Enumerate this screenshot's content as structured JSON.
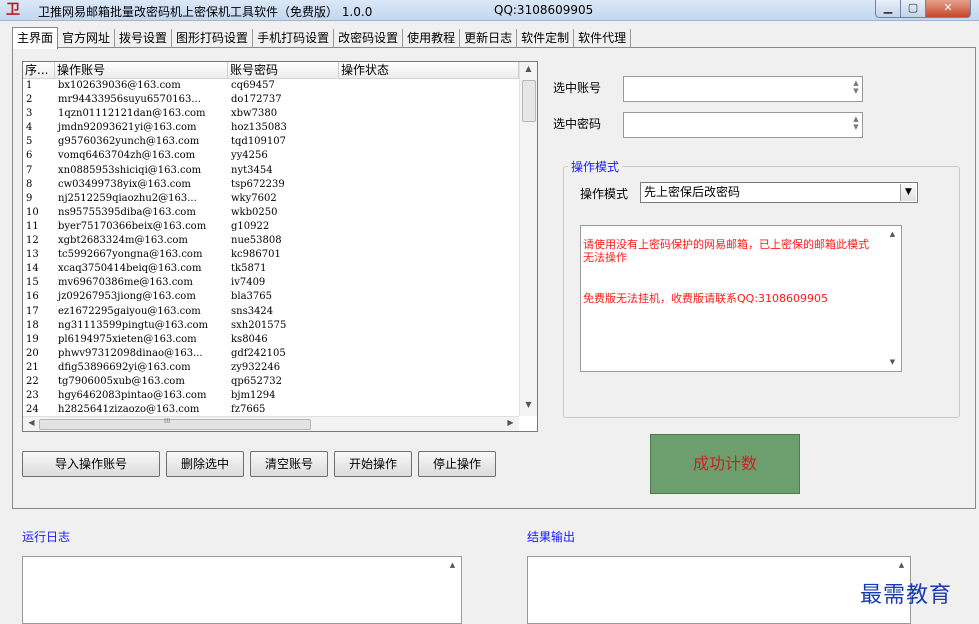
{
  "window": {
    "title": "卫推网易邮箱批量改密码机上密保机工具软件（免费版）  1.0.0",
    "qq": "QQ:3108609905",
    "min_label": "▁",
    "max_label": "▢",
    "close_label": "✕"
  },
  "tabs": [
    "主界面",
    "官方网址",
    "拨号设置",
    "图形打码设置",
    "手机打码设置",
    "改密码设置",
    "使用教程",
    "更新日志",
    "软件定制",
    "软件代理"
  ],
  "list": {
    "headers": [
      "序...",
      "操作账号",
      "账号密码",
      "操作状态"
    ],
    "rows": [
      [
        "1",
        "bx102639036@163.com",
        "cq69457",
        ""
      ],
      [
        "2",
        "mr94433956suyu6570163...",
        "do172737",
        ""
      ],
      [
        "3",
        "1qzn01112121dan@163.com",
        "xbw7380",
        ""
      ],
      [
        "4",
        "jmdn92093621yi@163.com",
        "hoz135083",
        ""
      ],
      [
        "5",
        "g95760362yunch@163.com",
        "tqd109107",
        ""
      ],
      [
        "6",
        "vomq6463704zh@163.com",
        "yy4256",
        ""
      ],
      [
        "7",
        "xn0885953shiciqi@163.com",
        "nyt3454",
        ""
      ],
      [
        "8",
        "cw03499738yix@163.com",
        "tsp672239",
        ""
      ],
      [
        "9",
        "nj2512259qiaozhu2@163...",
        "wky7602",
        ""
      ],
      [
        "10",
        "ns95755395diba@163.com",
        "wkb0250",
        ""
      ],
      [
        "11",
        "byer75170366beix@163.com",
        "g10922",
        ""
      ],
      [
        "12",
        "xgbt2683324m@163.com",
        "nue53808",
        ""
      ],
      [
        "13",
        "tc5992667yongna@163.com",
        "kc986701",
        ""
      ],
      [
        "14",
        "xcaq3750414beiq@163.com",
        "tk5871",
        ""
      ],
      [
        "15",
        "mv69670386me@163.com",
        "iv7409",
        ""
      ],
      [
        "16",
        "jz09267953jiong@163.com",
        "bla3765",
        ""
      ],
      [
        "17",
        "ez1672295gaiyou@163.com",
        "sns3424",
        ""
      ],
      [
        "18",
        "ng31113599pingtu@163.com",
        "sxh201575",
        ""
      ],
      [
        "19",
        "pl6194975xieten@163.com",
        "ks8046",
        ""
      ],
      [
        "20",
        "phwv97312098dinao@163...",
        "gdf242105",
        ""
      ],
      [
        "21",
        "dfig53896692yi@163.com",
        "zy932246",
        ""
      ],
      [
        "22",
        "tg7906005xub@163.com",
        "qp652732",
        ""
      ],
      [
        "23",
        "hgy6462083pintao@163.com",
        "bjm1294",
        ""
      ],
      [
        "24",
        "h2825641zizaozo@163.com",
        "fz7665",
        ""
      ]
    ],
    "hscroll_label": "III"
  },
  "buttons": {
    "import": "导入操作账号",
    "delete": "删除选中",
    "clear": "清空账号",
    "start": "开始操作",
    "stop": "停止操作"
  },
  "fields": {
    "selected_account_label": "选中账号",
    "selected_password_label": "选中密码",
    "selected_account_value": "",
    "selected_password_value": ""
  },
  "mode": {
    "group_title": "操作模式",
    "label": "操作模式",
    "selected": "先上密保后改密码",
    "message1": "请使用没有上密码保护的网易邮箱，已上密保的邮箱此模式无法操作",
    "message2": "免费版无法挂机，收费版请联系QQ:3108609905"
  },
  "success_counter": "成功计数",
  "run_log_title": "运行日志",
  "result_output_title": "结果输出",
  "watermark": "最需教育",
  "colors": {
    "accent_blue": "#1a1aff",
    "warning_red": "#ff1a1a",
    "counter_green": "#6d9e6d"
  }
}
